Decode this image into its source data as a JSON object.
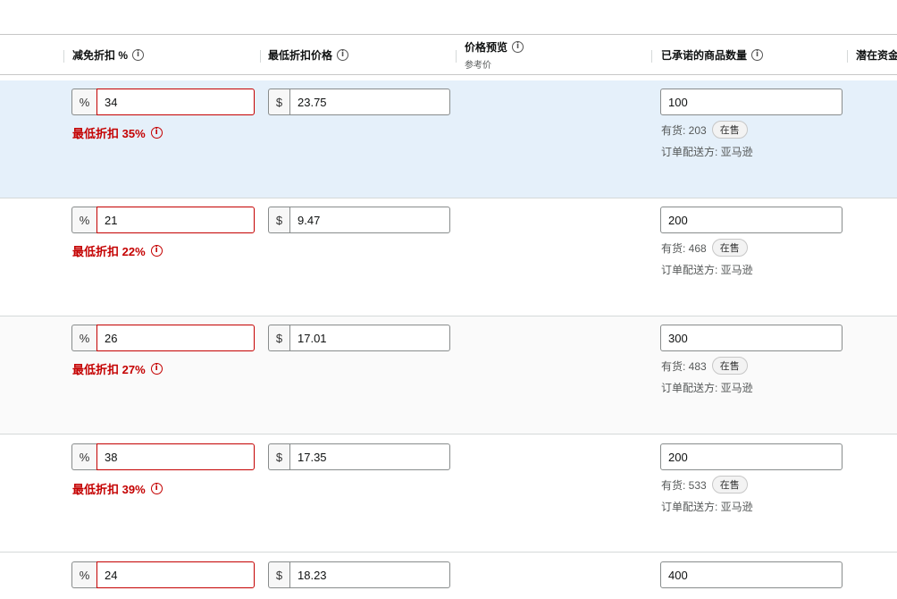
{
  "header": {
    "col_discount": "减免折扣 %",
    "col_min_price": "最低折扣价格",
    "col_preview": "价格预览",
    "col_preview_sub": "参考价",
    "col_quantity": "已承诺的商品数量",
    "col_potential": "潜在资金"
  },
  "symbols": {
    "percent": "%",
    "dollar": "$",
    "info": "i"
  },
  "rows": [
    {
      "discount": "34",
      "price": "23.75",
      "quantity": "100",
      "min_discount_msg": "最低折扣 35%",
      "stock": "有货: 203",
      "badge": "在售",
      "fulfilment": "订单配送方: 亚马逊"
    },
    {
      "discount": "21",
      "price": "9.47",
      "quantity": "200",
      "min_discount_msg": "最低折扣 22%",
      "stock": "有货: 468",
      "badge": "在售",
      "fulfilment": "订单配送方: 亚马逊"
    },
    {
      "discount": "26",
      "price": "17.01",
      "quantity": "300",
      "min_discount_msg": "最低折扣 27%",
      "stock": "有货: 483",
      "badge": "在售",
      "fulfilment": "订单配送方: 亚马逊"
    },
    {
      "discount": "38",
      "price": "17.35",
      "quantity": "200",
      "min_discount_msg": "最低折扣 39%",
      "stock": "有货: 533",
      "badge": "在售",
      "fulfilment": "订单配送方: 亚马逊"
    },
    {
      "discount": "24",
      "price": "18.23",
      "quantity": "400"
    }
  ],
  "colors": {
    "error": "#c40000",
    "highlight_row": "#e5f0fa"
  }
}
